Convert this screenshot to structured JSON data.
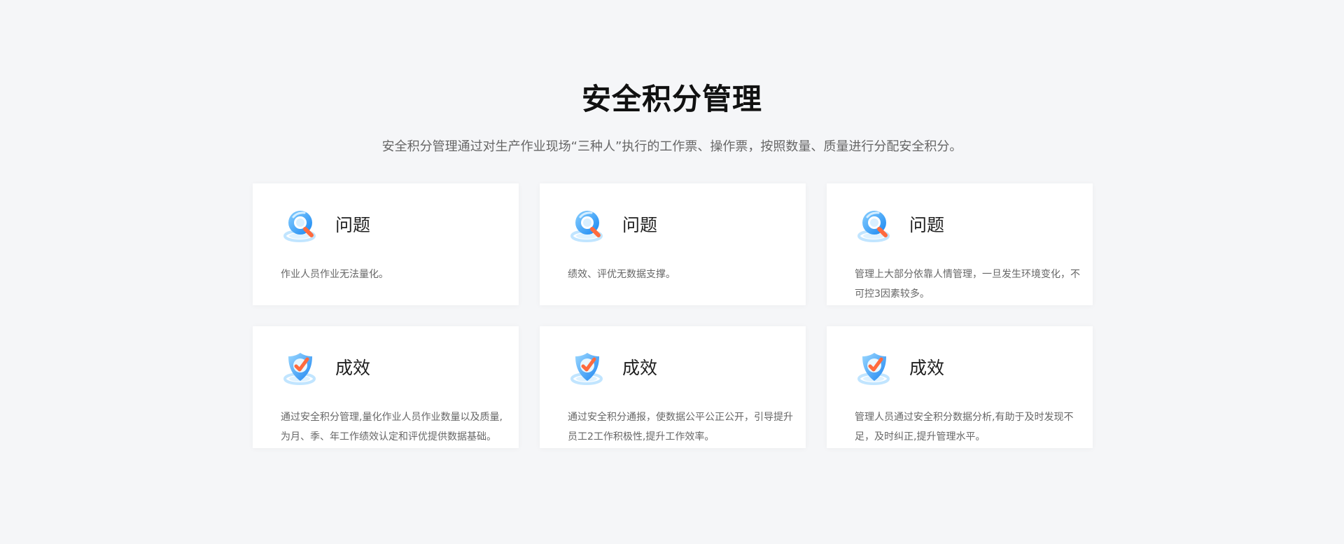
{
  "header": {
    "title": "安全积分管理",
    "subtitle": "安全积分管理通过对生产作业现场“三种人”执行的工作票、操作票，按照数量、质量进行分配安全积分。"
  },
  "cards": [
    {
      "icon": "search-icon",
      "title": "问题",
      "description": "作业人员作业无法量化。"
    },
    {
      "icon": "search-icon",
      "title": "问题",
      "description": "绩效、评优无数据支撑。"
    },
    {
      "icon": "search-icon",
      "title": "问题",
      "description": "管理上大部分依靠人情管理，一旦发生环境变化，不可控3因素较多。"
    },
    {
      "icon": "check-shield-icon",
      "title": "成效",
      "description": "通过安全积分管理,量化作业人员作业数量以及质量,为月、季、年工作绩效认定和评优提供数据基础。"
    },
    {
      "icon": "check-shield-icon",
      "title": "成效",
      "description": "通过安全积分通报，使数据公平公正公开，引导提升员工2工作积极性,提升工作效率。"
    },
    {
      "icon": "check-shield-icon",
      "title": "成效",
      "description": "管理人员通过安全积分数据分析,有助于及时发现不足，及时纠正,提升管理水平。"
    }
  ],
  "colors": {
    "background": "#f5f6f8",
    "card": "#ffffff",
    "icon_blue": "#2f8ff7",
    "icon_accent": "#ff6a3d"
  }
}
